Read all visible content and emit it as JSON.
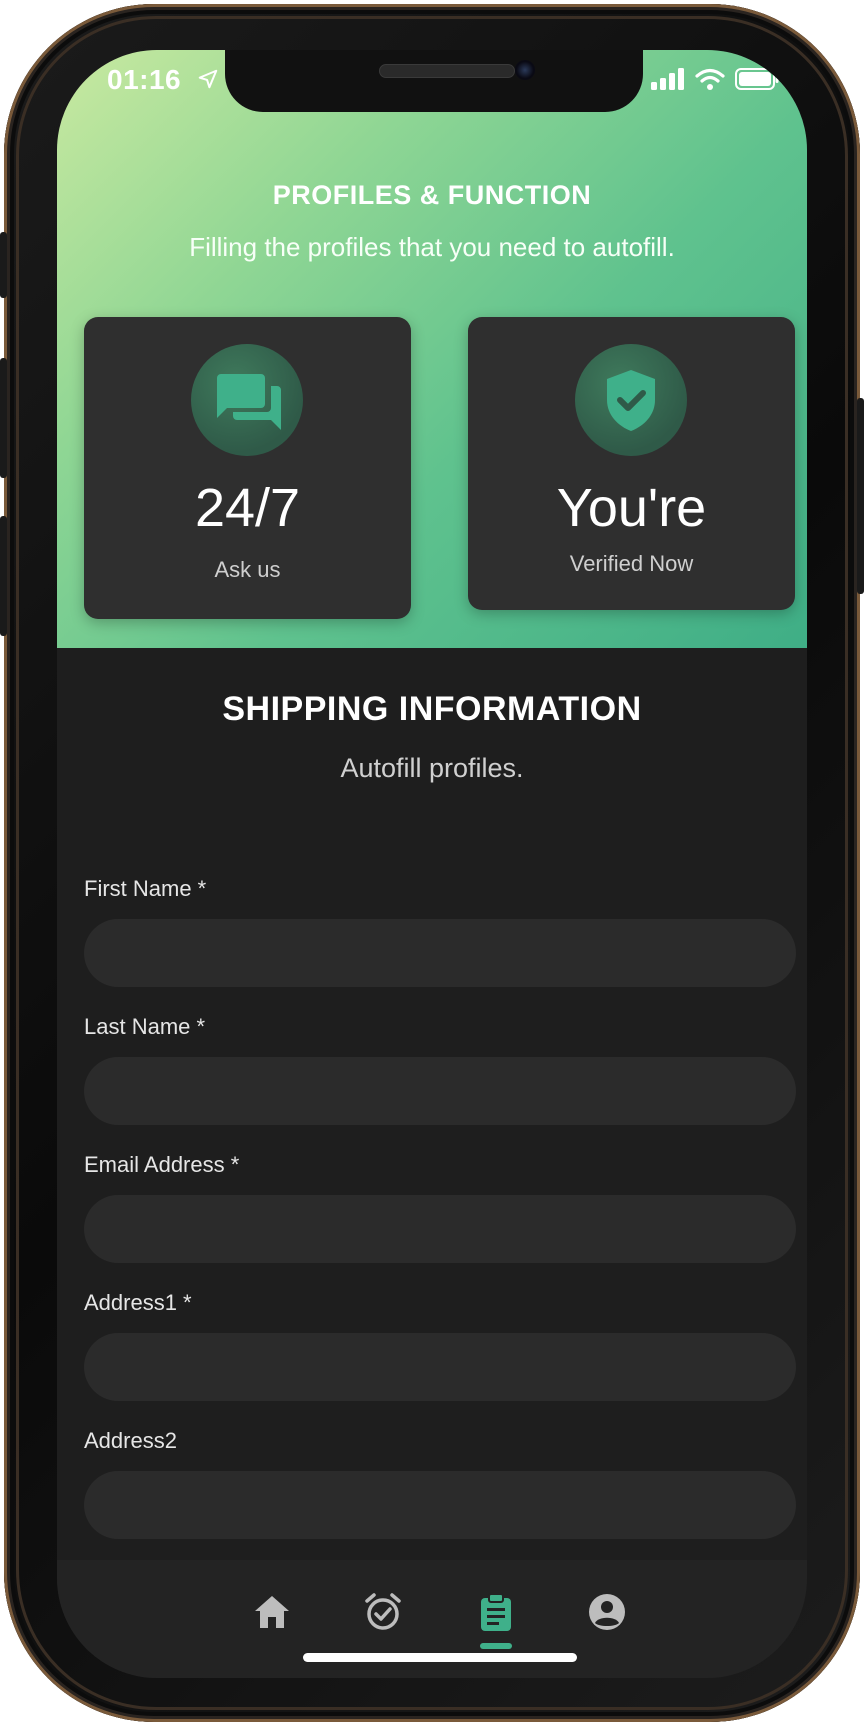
{
  "status_bar": {
    "time": "01:16"
  },
  "hero": {
    "title": "PROFILES & FUNCTION",
    "subtitle": "Filling the profiles that you need to autofill."
  },
  "cards": [
    {
      "icon": "chat-icon",
      "big": "24/7",
      "small": "Ask us"
    },
    {
      "icon": "shield-check-icon",
      "big": "You're",
      "small": "Verified Now"
    }
  ],
  "form": {
    "title": "SHIPPING INFORMATION",
    "subtitle": "Autofill profiles.",
    "fields": [
      {
        "label": "First Name *",
        "value": ""
      },
      {
        "label": "Last Name *",
        "value": ""
      },
      {
        "label": "Email Address *",
        "value": ""
      },
      {
        "label": "Address1 *",
        "value": ""
      },
      {
        "label": "Address2",
        "value": ""
      }
    ]
  },
  "tabs": [
    {
      "icon": "home-icon",
      "active": false
    },
    {
      "icon": "alarm-check-icon",
      "active": false
    },
    {
      "icon": "clipboard-icon",
      "active": true
    },
    {
      "icon": "account-icon",
      "active": false
    }
  ],
  "colors": {
    "accent": "#3fb08a",
    "card": "#2f2f2f",
    "background": "#1e1e1e",
    "input": "#2b2b2b"
  }
}
